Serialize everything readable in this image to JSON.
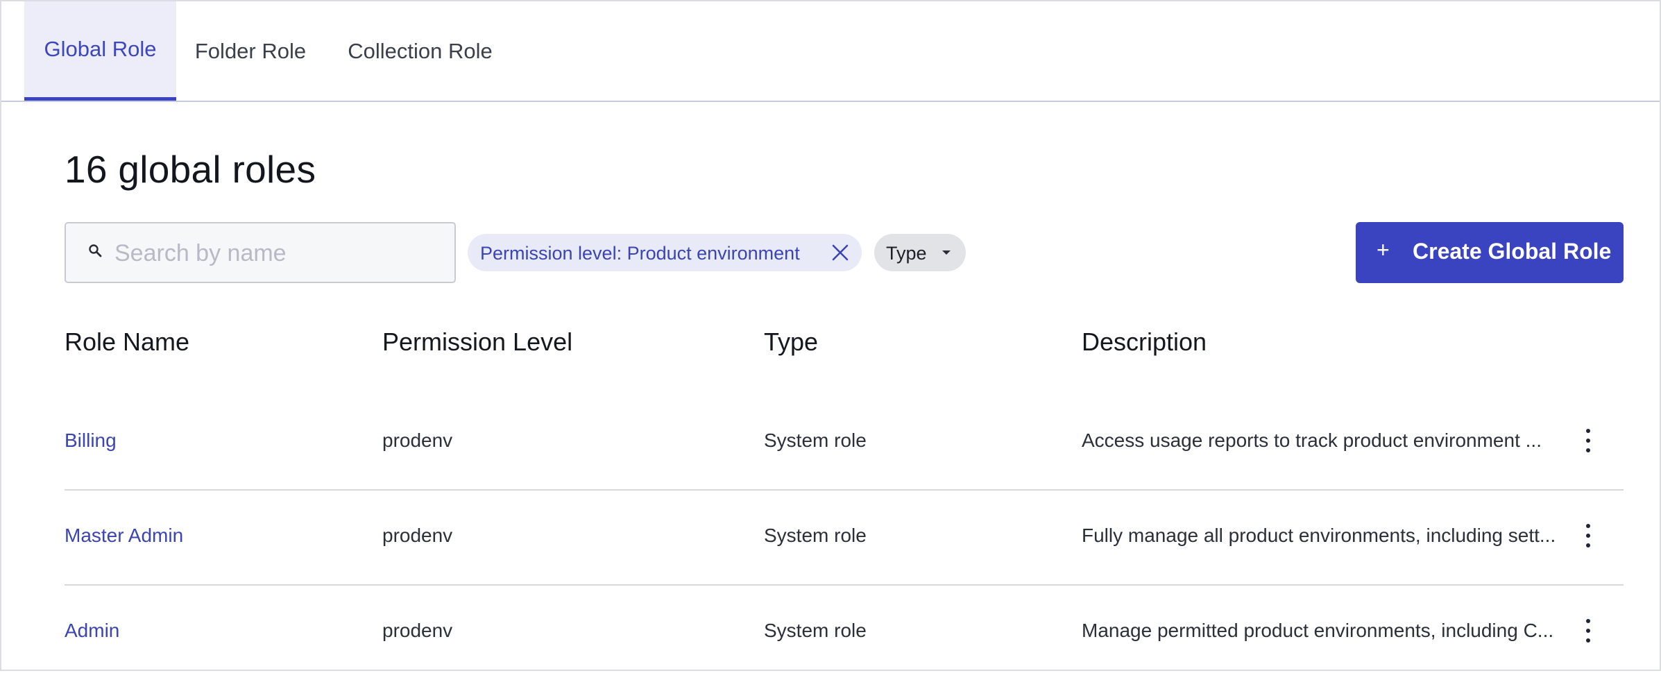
{
  "tabs": [
    {
      "label": "Global Role",
      "active": true
    },
    {
      "label": "Folder Role",
      "active": false
    },
    {
      "label": "Collection Role",
      "active": false
    }
  ],
  "page": {
    "title": "16 global roles"
  },
  "search": {
    "placeholder": "Search by name",
    "value": ""
  },
  "filters": {
    "permission_chip": "Permission level: Product environment",
    "type_chip": "Type"
  },
  "actions": {
    "create_label": "Create Global Role",
    "create_icon": "plus-icon"
  },
  "table": {
    "headers": [
      "Role Name",
      "Permission Level",
      "Type",
      "Description"
    ],
    "rows": [
      {
        "name": "Billing",
        "permission": "prodenv",
        "type": "System role",
        "description": "Access usage reports to track product environment ..."
      },
      {
        "name": "Master Admin",
        "permission": "prodenv",
        "type": "System role",
        "description": "Fully manage all product environments, including sett..."
      },
      {
        "name": "Admin",
        "permission": "prodenv",
        "type": "System role",
        "description": "Manage permitted product environments, including C..."
      }
    ]
  },
  "colors": {
    "accent": "#3a44c0",
    "accent_text": "#3a44b3",
    "tab_active_bg": "#ecedf8",
    "chip_filter_bg": "#e9eaf8",
    "chip_type_bg": "#e2e3e6"
  }
}
